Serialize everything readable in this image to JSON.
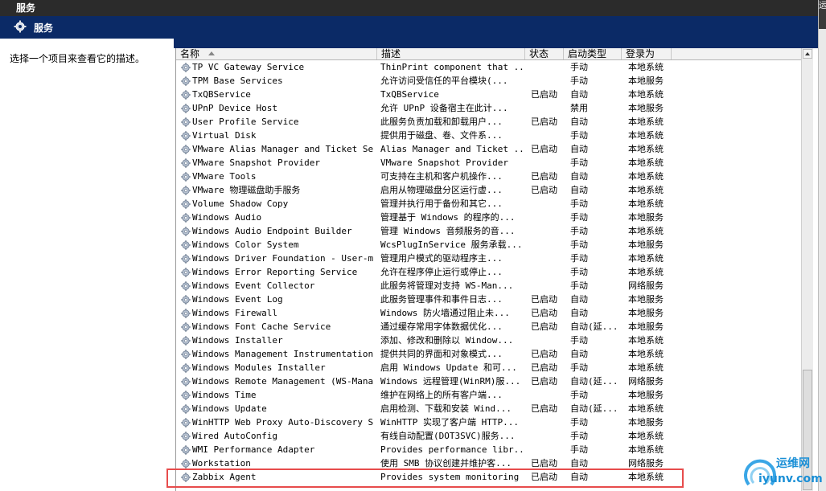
{
  "window": {
    "title": "服务",
    "right_tab": "运"
  },
  "header": {
    "title": "服务"
  },
  "left_pane": {
    "description": "选择一个项目来查看它的描述。"
  },
  "columns": {
    "name": "名称",
    "desc": "描述",
    "status": "状态",
    "startup": "启动类型",
    "logon": "登录为"
  },
  "rows": [
    {
      "name": "TP VC Gateway Service",
      "desc": "ThinPrint component that ...",
      "status": "",
      "startup": "手动",
      "logon": "本地系统"
    },
    {
      "name": "TPM Base Services",
      "desc": "允许访问受信任的平台模块(...",
      "status": "",
      "startup": "手动",
      "logon": "本地服务"
    },
    {
      "name": "TxQBService",
      "desc": "TxQBService",
      "status": "已启动",
      "startup": "自动",
      "logon": "本地系统"
    },
    {
      "name": "UPnP Device Host",
      "desc": "允许 UPnP 设备宿主在此计...",
      "status": "",
      "startup": "禁用",
      "logon": "本地服务"
    },
    {
      "name": "User Profile Service",
      "desc": "此服务负责加载和卸载用户...",
      "status": "已启动",
      "startup": "自动",
      "logon": "本地系统"
    },
    {
      "name": "Virtual Disk",
      "desc": "提供用于磁盘、卷、文件系...",
      "status": "",
      "startup": "手动",
      "logon": "本地系统"
    },
    {
      "name": "VMware Alias Manager and Ticket Se...",
      "desc": "Alias Manager and Ticket ...",
      "status": "已启动",
      "startup": "自动",
      "logon": "本地系统"
    },
    {
      "name": "VMware Snapshot Provider",
      "desc": "VMware Snapshot Provider",
      "status": "",
      "startup": "手动",
      "logon": "本地系统"
    },
    {
      "name": "VMware Tools",
      "desc": "可支持在主机和客户机操作...",
      "status": "已启动",
      "startup": "自动",
      "logon": "本地系统"
    },
    {
      "name": "VMware 物理磁盘助手服务",
      "desc": "启用从物理磁盘分区运行虚...",
      "status": "已启动",
      "startup": "自动",
      "logon": "本地系统"
    },
    {
      "name": "Volume Shadow Copy",
      "desc": "管理并执行用于备份和其它...",
      "status": "",
      "startup": "手动",
      "logon": "本地系统"
    },
    {
      "name": "Windows Audio",
      "desc": "管理基于 Windows 的程序的...",
      "status": "",
      "startup": "手动",
      "logon": "本地服务"
    },
    {
      "name": "Windows Audio Endpoint Builder",
      "desc": "管理 Windows 音频服务的音...",
      "status": "",
      "startup": "手动",
      "logon": "本地系统"
    },
    {
      "name": "Windows Color System",
      "desc": "WcsPlugInService 服务承载...",
      "status": "",
      "startup": "手动",
      "logon": "本地服务"
    },
    {
      "name": "Windows Driver Foundation - User-m...",
      "desc": "管理用户模式的驱动程序主...",
      "status": "",
      "startup": "手动",
      "logon": "本地系统"
    },
    {
      "name": "Windows Error Reporting Service",
      "desc": "允许在程序停止运行或停止...",
      "status": "",
      "startup": "手动",
      "logon": "本地系统"
    },
    {
      "name": "Windows Event Collector",
      "desc": "此服务将管理对支持 WS-Man...",
      "status": "",
      "startup": "手动",
      "logon": "网络服务"
    },
    {
      "name": "Windows Event Log",
      "desc": "此服务管理事件和事件日志...",
      "status": "已启动",
      "startup": "自动",
      "logon": "本地服务"
    },
    {
      "name": "Windows Firewall",
      "desc": "Windows 防火墙通过阻止未...",
      "status": "已启动",
      "startup": "自动",
      "logon": "本地服务"
    },
    {
      "name": "Windows Font Cache Service",
      "desc": "通过缓存常用字体数据优化...",
      "status": "已启动",
      "startup": "自动(延...",
      "logon": "本地服务"
    },
    {
      "name": "Windows Installer",
      "desc": "添加、修改和删除以 Window...",
      "status": "",
      "startup": "手动",
      "logon": "本地系统"
    },
    {
      "name": "Windows Management Instrumentation",
      "desc": "提供共同的界面和对象模式...",
      "status": "已启动",
      "startup": "自动",
      "logon": "本地系统"
    },
    {
      "name": "Windows Modules Installer",
      "desc": "启用 Windows Update 和可...",
      "status": "已启动",
      "startup": "手动",
      "logon": "本地系统"
    },
    {
      "name": "Windows Remote Management (WS-Mana...",
      "desc": "Windows 远程管理(WinRM)服...",
      "status": "已启动",
      "startup": "自动(延...",
      "logon": "网络服务"
    },
    {
      "name": "Windows Time",
      "desc": "维护在网络上的所有客户端...",
      "status": "",
      "startup": "手动",
      "logon": "本地服务"
    },
    {
      "name": "Windows Update",
      "desc": "启用检测、下载和安装 Wind...",
      "status": "已启动",
      "startup": "自动(延...",
      "logon": "本地系统"
    },
    {
      "name": "WinHTTP Web Proxy Auto-Discovery S...",
      "desc": "WinHTTP 实现了客户端 HTTP...",
      "status": "",
      "startup": "手动",
      "logon": "本地服务"
    },
    {
      "name": "Wired AutoConfig",
      "desc": "有线自动配置(DOT3SVC)服务...",
      "status": "",
      "startup": "手动",
      "logon": "本地系统"
    },
    {
      "name": "WMI Performance Adapter",
      "desc": "Provides performance libr...",
      "status": "",
      "startup": "手动",
      "logon": "本地系统"
    },
    {
      "name": "Workstation",
      "desc": "使用 SMB 协议创建并维护客...",
      "status": "已启动",
      "startup": "自动",
      "logon": "网络服务"
    },
    {
      "name": "Zabbix Agent",
      "desc": "Provides system monitoring",
      "status": "已启动",
      "startup": "自动",
      "logon": "本地系统"
    }
  ],
  "watermark": {
    "line1": "运维网",
    "line2": "iyunv.com"
  }
}
